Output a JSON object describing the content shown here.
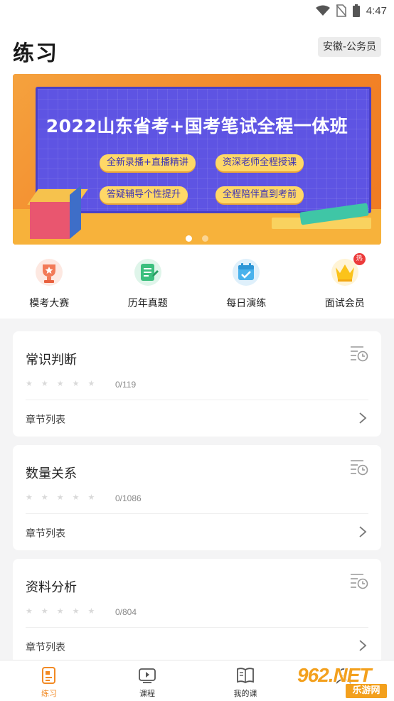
{
  "status_bar": {
    "time": "4:47",
    "icons": [
      "wifi-icon",
      "no-sim-icon",
      "battery-icon"
    ]
  },
  "header": {
    "title": "练习",
    "region": "安徽-公务员"
  },
  "banner": {
    "title": "2022山东省考+国考笔试全程一体班",
    "tags": [
      "全新录播+直播精讲",
      "资深老师全程授课",
      "答疑辅导个性提升",
      "全程陪伴直到考前"
    ],
    "slide_count": 2,
    "active_slide": 1
  },
  "quick_nav": [
    {
      "label": "模考大赛",
      "icon": "trophy-icon"
    },
    {
      "label": "历年真题",
      "icon": "document-pen-icon"
    },
    {
      "label": "每日演练",
      "icon": "calendar-check-icon"
    },
    {
      "label": "面试会员",
      "icon": "crown-icon",
      "badge": "热"
    }
  ],
  "cards": [
    {
      "title": "常识判断",
      "stars": 5,
      "count": "0/119",
      "row_label": "章节列表"
    },
    {
      "title": "数量关系",
      "stars": 5,
      "count": "0/1086",
      "row_label": "章节列表"
    },
    {
      "title": "资料分析",
      "stars": 5,
      "count": "0/804",
      "row_label": "章节列表"
    }
  ],
  "tab_bar": [
    {
      "label": "练习",
      "icon": "practice-icon",
      "active": true
    },
    {
      "label": "课程",
      "icon": "video-course-icon",
      "active": false
    },
    {
      "label": "我的课",
      "icon": "my-course-book-icon",
      "active": false
    },
    {
      "label": "",
      "icon": "profile-icon",
      "active": false
    }
  ],
  "watermark": {
    "main": "962.NET",
    "sub": "乐游网"
  },
  "colors": {
    "accent": "#f28a24",
    "banner_board": "#5e54e3",
    "tag_bg": "#ffd867",
    "hot_badge": "#ec3b3b"
  }
}
